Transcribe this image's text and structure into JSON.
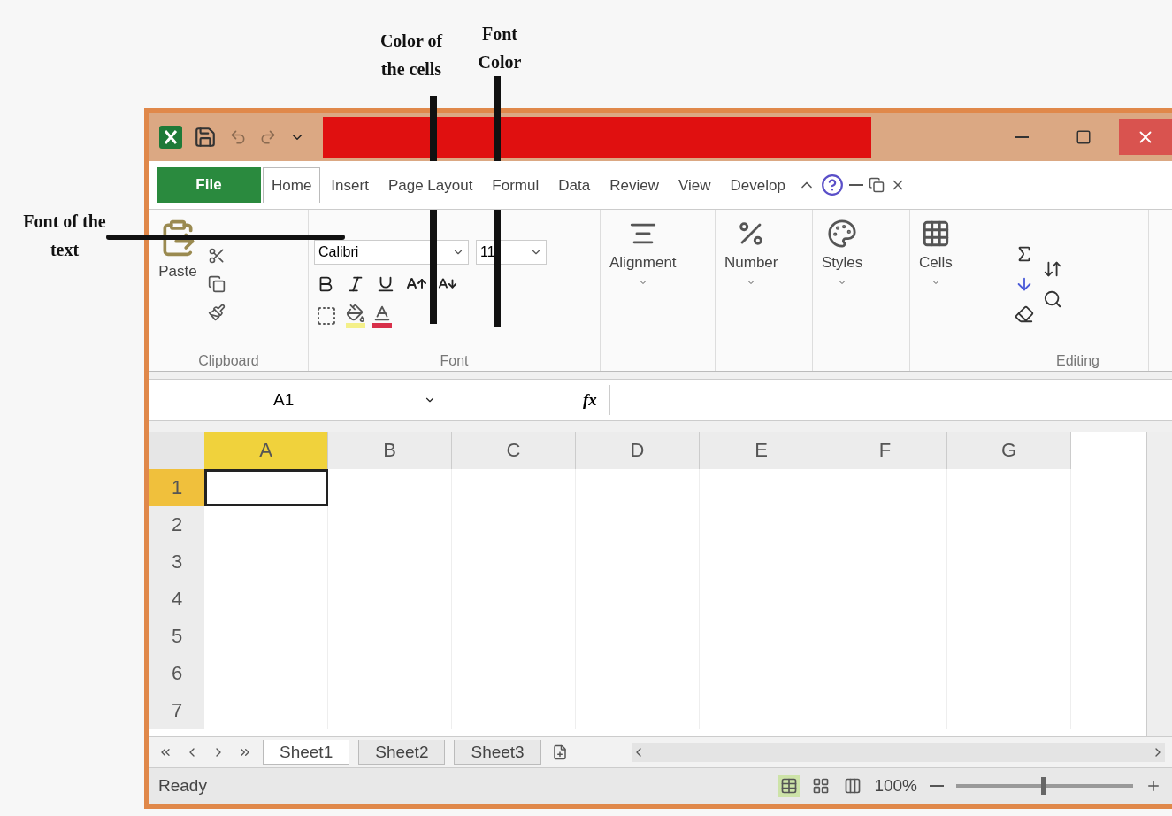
{
  "annotations": [
    {
      "text": "Color of the cells"
    },
    {
      "text": "Font Color"
    },
    {
      "text": "Font of the text"
    }
  ],
  "tabs": [
    {
      "label": "File",
      "kind": "file",
      "selected": false
    },
    {
      "label": "Home",
      "kind": "tab",
      "selected": true
    },
    {
      "label": "Insert",
      "kind": "tab",
      "selected": false
    },
    {
      "label": "Page Layout",
      "kind": "tab",
      "selected": false
    },
    {
      "label": "Formul",
      "kind": "tab",
      "selected": false
    },
    {
      "label": "Data",
      "kind": "tab",
      "selected": false
    },
    {
      "label": "Review",
      "kind": "tab",
      "selected": false
    },
    {
      "label": "View",
      "kind": "tab",
      "selected": false
    },
    {
      "label": "Develop",
      "kind": "tab",
      "selected": false
    }
  ],
  "ribbon": {
    "clipboard": {
      "paste_label": "Paste",
      "group_label": "Clipboard"
    },
    "font": {
      "font_name": "Calibri",
      "font_size": "11",
      "group_label": "Font"
    },
    "groups": [
      {
        "label": "Alignment",
        "kind": "alignment"
      },
      {
        "label": "Number",
        "kind": "number"
      },
      {
        "label": "Styles",
        "kind": "styles"
      },
      {
        "label": "Cells",
        "kind": "cells"
      }
    ],
    "editing": {
      "group_label": "Editing"
    }
  },
  "formula_bar": {
    "name_box": "A1",
    "fx_label": "fx"
  },
  "grid": {
    "columns": [
      {
        "label": "A",
        "selected": true
      },
      {
        "label": "B",
        "selected": false
      },
      {
        "label": "C",
        "selected": false
      },
      {
        "label": "D",
        "selected": false
      },
      {
        "label": "E",
        "selected": false
      },
      {
        "label": "F",
        "selected": false
      },
      {
        "label": "G",
        "selected": false
      }
    ],
    "rows": [
      {
        "label": "1",
        "selected": true
      },
      {
        "label": "2",
        "selected": false
      },
      {
        "label": "3",
        "selected": false
      },
      {
        "label": "4",
        "selected": false
      },
      {
        "label": "5",
        "selected": false
      },
      {
        "label": "6",
        "selected": false
      },
      {
        "label": "7",
        "selected": false
      }
    ]
  },
  "sheet_tabs": [
    {
      "label": "Sheet1",
      "selected": true
    },
    {
      "label": "Sheet2",
      "selected": false
    },
    {
      "label": "Sheet3",
      "selected": false
    }
  ],
  "status_bar": {
    "text": "Ready",
    "zoom": "100%"
  }
}
